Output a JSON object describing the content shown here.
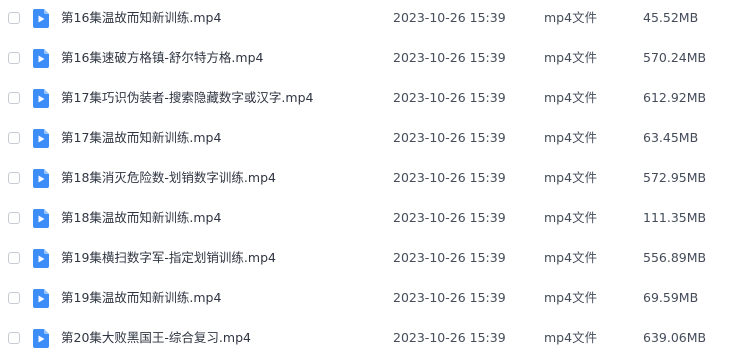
{
  "file_list": {
    "columns_visible": [
      "name",
      "modified",
      "type",
      "size"
    ],
    "icon": "mp4-video-file-icon",
    "icon_color": "#3d8ef8",
    "rows": [
      {
        "name": "第16集温故而知新训练.mp4",
        "date": "2023-10-26 15:39",
        "type": "mp4文件",
        "size": "45.52MB"
      },
      {
        "name": "第16集速破方格镇-舒尔特方格.mp4",
        "date": "2023-10-26 15:39",
        "type": "mp4文件",
        "size": "570.24MB"
      },
      {
        "name": "第17集巧识伪装者-搜索隐藏数字或汉字.mp4",
        "date": "2023-10-26 15:39",
        "type": "mp4文件",
        "size": "612.92MB"
      },
      {
        "name": "第17集温故而知新训练.mp4",
        "date": "2023-10-26 15:39",
        "type": "mp4文件",
        "size": "63.45MB"
      },
      {
        "name": "第18集消灭危险数-划销数字训练.mp4",
        "date": "2023-10-26 15:39",
        "type": "mp4文件",
        "size": "572.95MB"
      },
      {
        "name": "第18集温故而知新训练.mp4",
        "date": "2023-10-26 15:39",
        "type": "mp4文件",
        "size": "111.35MB"
      },
      {
        "name": "第19集横扫数字军-指定划销训练.mp4",
        "date": "2023-10-26 15:39",
        "type": "mp4文件",
        "size": "556.89MB"
      },
      {
        "name": "第19集温故而知新训练.mp4",
        "date": "2023-10-26 15:39",
        "type": "mp4文件",
        "size": "69.59MB"
      },
      {
        "name": "第20集大败黑国王-综合复习.mp4",
        "date": "2023-10-26 15:39",
        "type": "mp4文件",
        "size": "639.06MB"
      }
    ]
  }
}
